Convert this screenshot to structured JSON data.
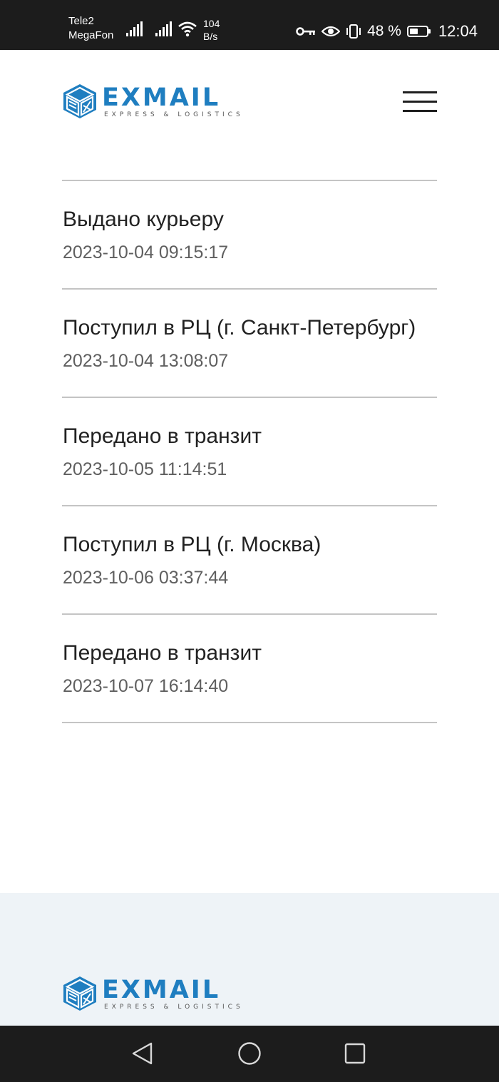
{
  "status_bar": {
    "carrier_1": "Tele2",
    "carrier_2": "MegaFon",
    "net_speed_value": "104",
    "net_speed_unit": "B/s",
    "battery_percent": "48 %",
    "time": "12:04",
    "icons": [
      "signal-icon",
      "signal-icon",
      "wifi-icon",
      "key-icon",
      "eye-icon",
      "vibrate-icon",
      "battery-icon"
    ]
  },
  "header": {
    "logo_word": "EXMAIL",
    "logo_tagline": "EXPRESS & LOGISTICS",
    "menu_icon": "hamburger-menu-icon"
  },
  "colors": {
    "brand_blue": "#1f7ec0",
    "divider": "#c4c4c4",
    "footer_bg": "#eef3f7",
    "system_bar": "#1c1c1c"
  },
  "events": [
    {
      "status": "Выдано курьеру",
      "timestamp": "2023-10-04 09:15:17"
    },
    {
      "status": "Поступил в РЦ (г. Санкт-Петербург)",
      "timestamp": "2023-10-04 13:08:07"
    },
    {
      "status": "Передано в транзит",
      "timestamp": "2023-10-05 11:14:51"
    },
    {
      "status": "Поступил в РЦ (г. Москва)",
      "timestamp": "2023-10-06 03:37:44"
    },
    {
      "status": "Передано в транзит",
      "timestamp": "2023-10-07 16:14:40"
    }
  ],
  "footer": {
    "logo_word": "EXMAIL",
    "logo_tagline": "EXPRESS & LOGISTICS"
  },
  "nav_bar": {
    "buttons": [
      "back-icon",
      "home-icon",
      "recent-apps-icon"
    ]
  }
}
